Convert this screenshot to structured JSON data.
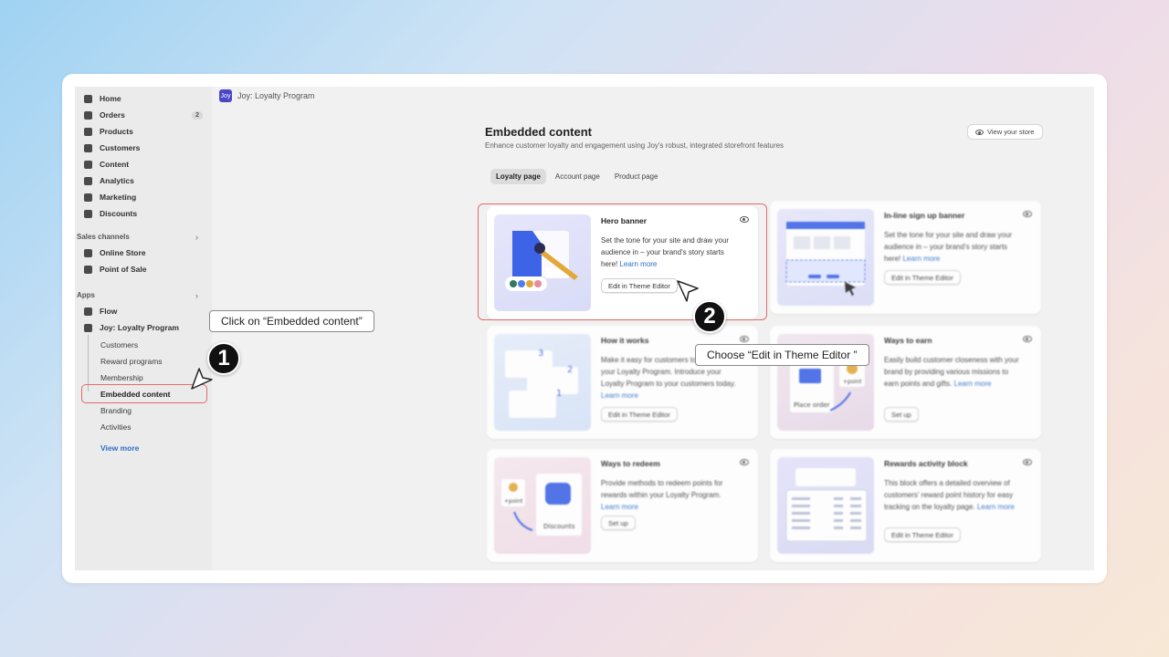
{
  "app_header": {
    "logo_text": "Joy",
    "title": "Joy: Loyalty Program"
  },
  "sidebar": {
    "main_items": [
      {
        "label": "Home",
        "icon": "home-icon"
      },
      {
        "label": "Orders",
        "icon": "orders-icon",
        "badge": "2"
      },
      {
        "label": "Products",
        "icon": "tag-icon"
      },
      {
        "label": "Customers",
        "icon": "person-icon"
      },
      {
        "label": "Content",
        "icon": "content-icon"
      },
      {
        "label": "Analytics",
        "icon": "chart-icon"
      },
      {
        "label": "Marketing",
        "icon": "marketing-icon"
      },
      {
        "label": "Discounts",
        "icon": "discount-icon"
      }
    ],
    "sales_channels_label": "Sales channels",
    "sales_channels": [
      {
        "label": "Online Store",
        "icon": "store-icon"
      },
      {
        "label": "Point of Sale",
        "icon": "pos-icon"
      }
    ],
    "apps_label": "Apps",
    "apps": [
      {
        "label": "Flow",
        "icon": "flow-icon"
      },
      {
        "label": "Joy: Loyalty Program",
        "icon": "joy-app-icon"
      }
    ],
    "sub_items": [
      "Customers",
      "Reward programs",
      "Membership",
      "Embedded content",
      "Branding",
      "Activities"
    ],
    "view_more": "View more"
  },
  "main": {
    "title": "Embedded content",
    "subtitle": "Enhance customer loyalty and engagement using Joy's robust, integrated storefront features",
    "view_store": "View your store",
    "tabs": [
      {
        "label": "Loyalty page",
        "active": true
      },
      {
        "label": "Account page",
        "active": false
      },
      {
        "label": "Product page",
        "active": false
      }
    ],
    "cards": [
      {
        "title": "Hero banner",
        "desc": "Set the tone for your site and draw your audience in – your brand's story starts here!",
        "learn": "Learn more",
        "button": "Edit in Theme Editor"
      },
      {
        "title": "In-line sign up banner",
        "desc": "Set the tone for your site and draw your audience in – your brand's story starts here!",
        "learn": "Learn more",
        "button": "Edit in Theme Editor"
      },
      {
        "title": "How it works",
        "desc": "Make it easy for customers to understand your Loyalty Program. Introduce your Loyalty Program to your customers today.",
        "learn": "Learn more",
        "button": "Edit in Theme Editor"
      },
      {
        "title": "Ways to earn",
        "desc": "Easily build customer closeness with your brand by providing various missions to earn points and gifts.",
        "learn": "Learn more",
        "button": "Set up"
      },
      {
        "title": "Ways to redeem",
        "desc": "Provide methods to redeem points for rewards within your Loyalty Program.",
        "learn": "Learn more",
        "button": "Set up"
      },
      {
        "title": "Rewards activity block",
        "desc": "This block offers a detailed overview of customers' reward point history for easy tracking on the loyalty page.",
        "learn": "Learn more",
        "button": "Edit in Theme Editor"
      }
    ],
    "thumb_labels": {
      "place_order": "Place order",
      "point_plus": "+point",
      "discounts": "Discounts"
    }
  },
  "annotations": {
    "step1_label": "Click on “Embedded content”",
    "step1_number": "1",
    "step2_label": "Choose “Edit in Theme Editor ”",
    "step2_number": "2"
  },
  "colors": {
    "highlight": "#e46a6a",
    "accent": "#2c6ecb",
    "brand": "#4a46c8"
  }
}
